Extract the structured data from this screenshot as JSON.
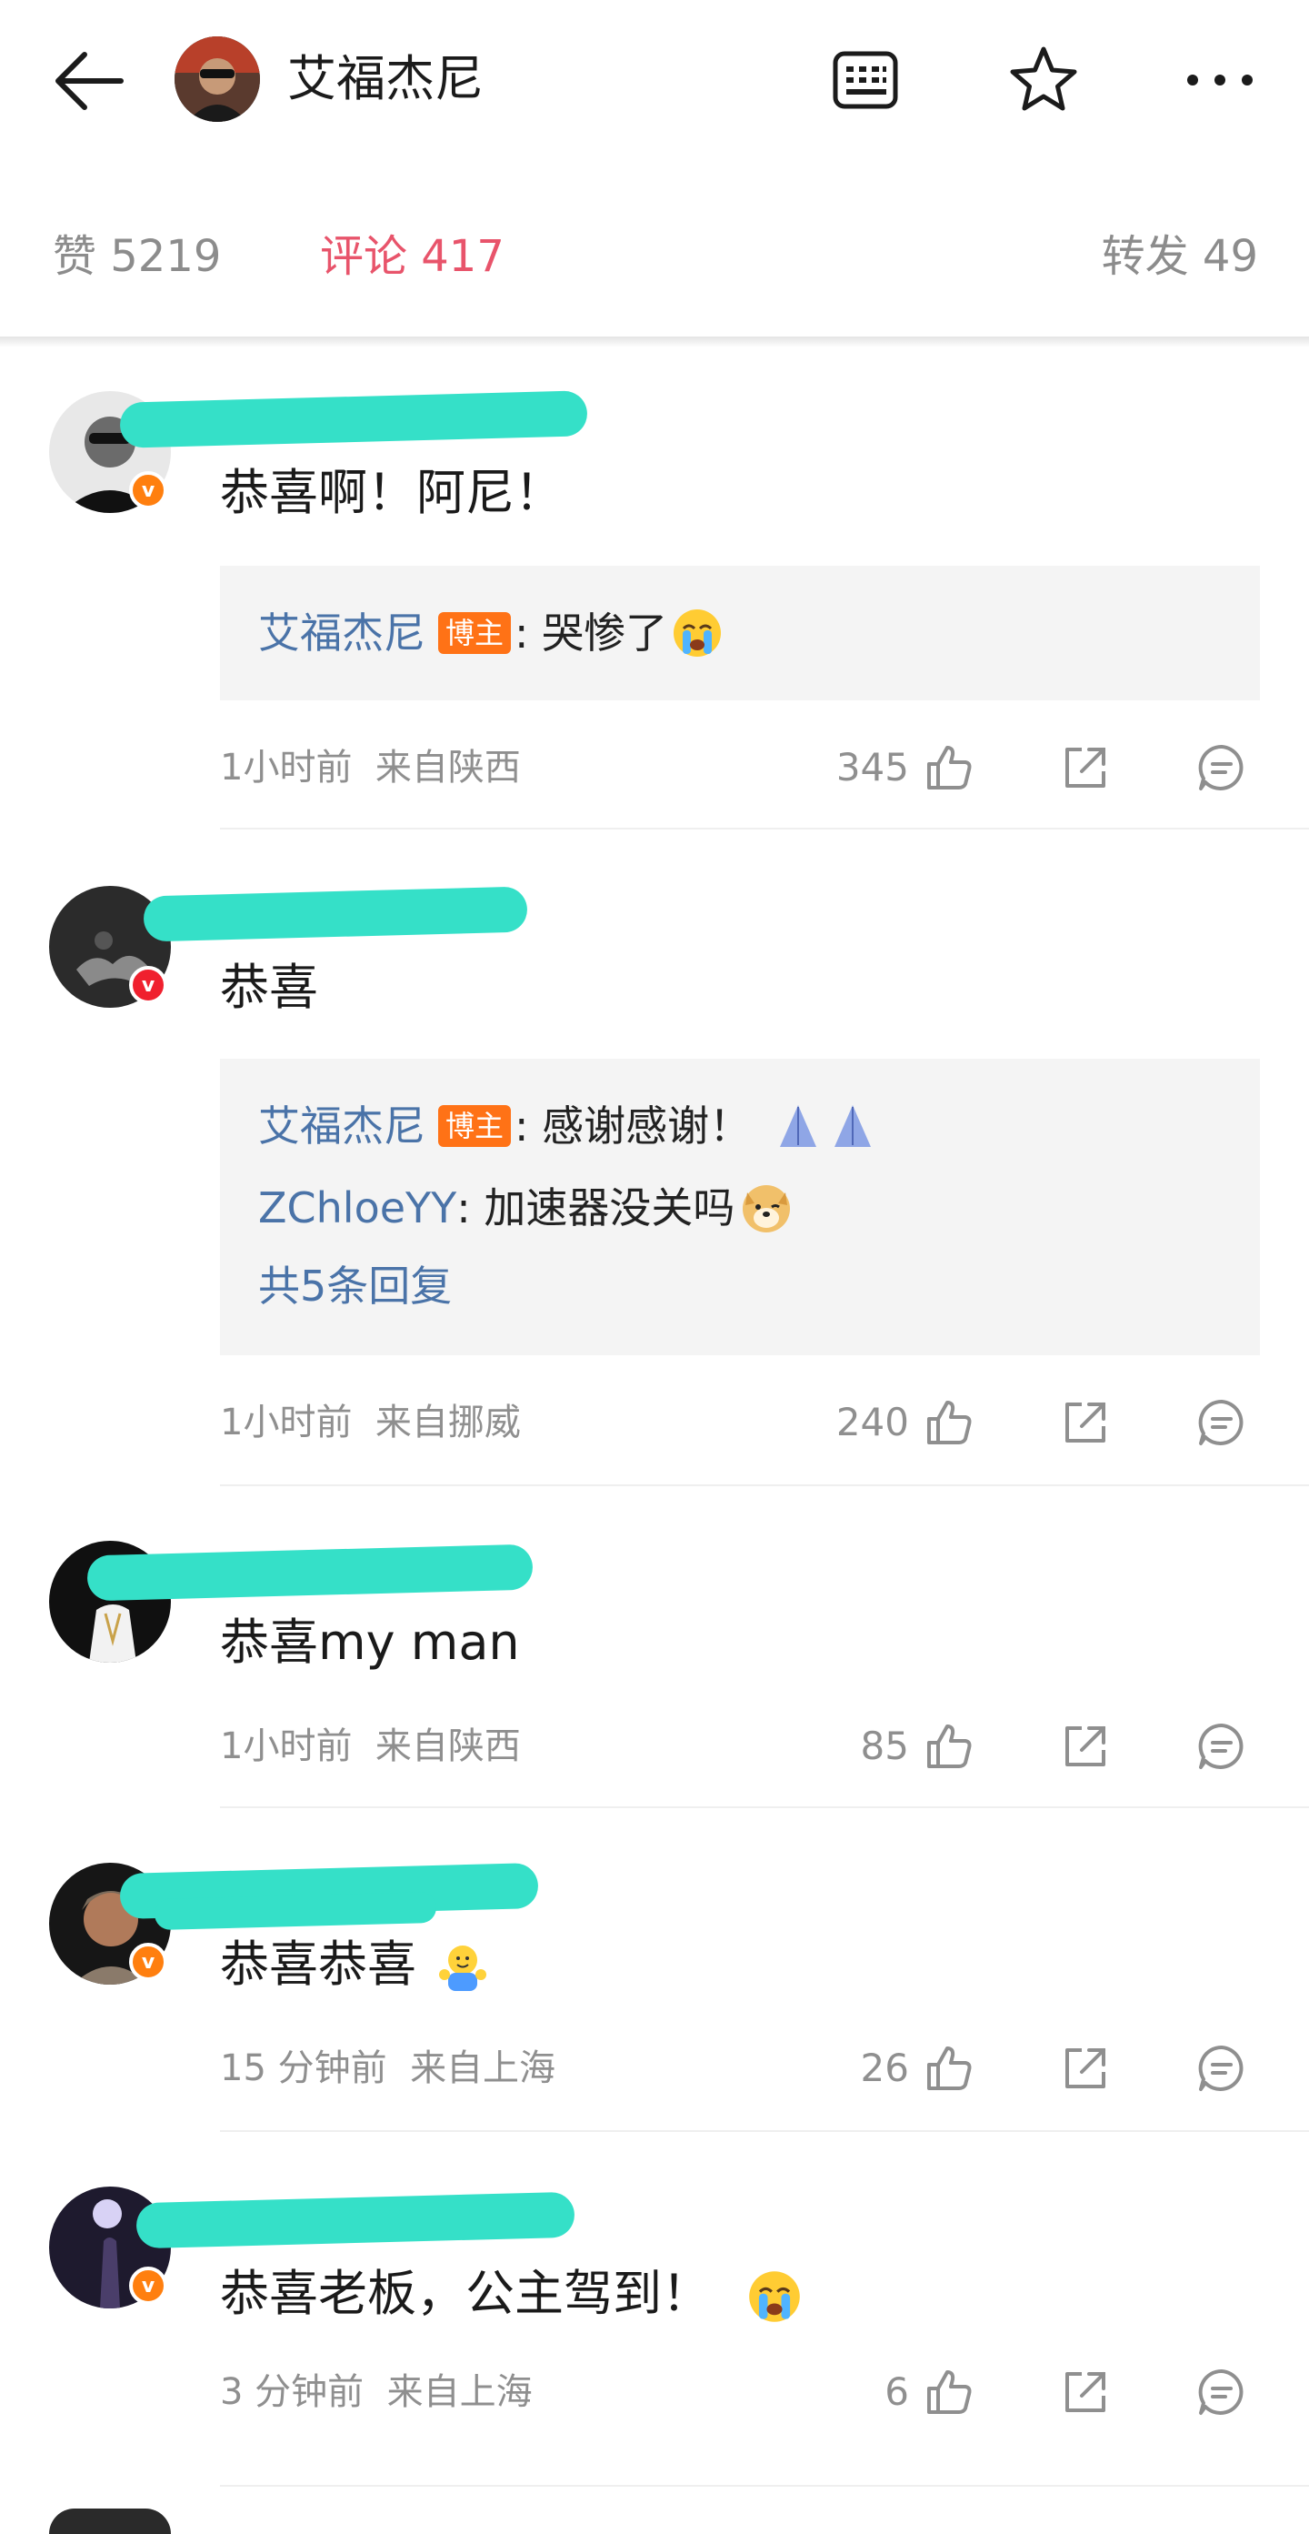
{
  "header": {
    "title": "艾福杰尼",
    "icons": [
      "back-arrow-icon",
      "keyboard-icon",
      "star-icon",
      "more-icon"
    ]
  },
  "stats": {
    "likes": "赞 5219",
    "comments": "评论 417",
    "reposts": "转发 49"
  },
  "comments": [
    {
      "text": "恭喜啊！阿尼！",
      "badge": "v",
      "replies": [
        {
          "name": "艾福杰尼",
          "tag": "博主",
          "text": ": 哭惨了",
          "emoji": "crying-emoji"
        }
      ],
      "time": "1小时前",
      "location": "来自陕西",
      "likes": "345"
    },
    {
      "text": "恭喜",
      "badge": "v",
      "replies": [
        {
          "name": "艾福杰尼",
          "tag": "博主",
          "text": ": 感谢感谢！",
          "emoji": "pray-emoji"
        },
        {
          "name": "ZChloeYY",
          "text": " : 加速器没关吗",
          "emoji": "doge-emoji"
        }
      ],
      "more_replies": "共5条回复",
      "time": "1小时前",
      "location": "来自挪威",
      "likes": "240"
    },
    {
      "text": "恭喜my man",
      "time": "1小时前",
      "location": "来自陕西",
      "likes": "85"
    },
    {
      "text": "恭喜恭喜",
      "badge": "v",
      "emoji": "hug-emoji",
      "time": "15 分钟前",
      "location": "来自上海",
      "likes": "26"
    },
    {
      "text": "恭喜老板，公主驾到！",
      "badge": "v",
      "emoji": "crying-emoji",
      "time": "3 分钟前",
      "location": "来自上海",
      "likes": "6"
    }
  ],
  "colors": {
    "active_tab": "#e8546b",
    "reply_name": "#4a73a8",
    "blogger_tag": "#ff7216",
    "verified_badge": "#ff7f0f",
    "redaction": "#35e0c8"
  }
}
